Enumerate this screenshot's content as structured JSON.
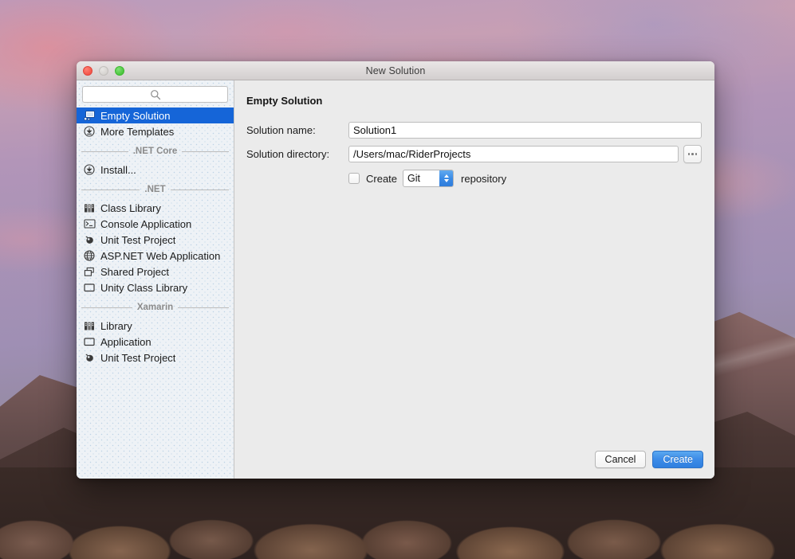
{
  "window": {
    "title": "New Solution",
    "traffic_lights": [
      {
        "name": "close",
        "color": "#f4564a"
      },
      {
        "name": "minimize",
        "color": "#d6d3d0"
      },
      {
        "name": "maximize",
        "color": "#4cc63d"
      }
    ]
  },
  "sidebar": {
    "search": {
      "value": "",
      "placeholder": "",
      "icon": "search-icon"
    },
    "top_items": [
      {
        "label": "Empty Solution",
        "icon": "empty-solution-icon",
        "selected": true
      },
      {
        "label": "More Templates",
        "icon": "download-circle-icon",
        "selected": false
      }
    ],
    "sections": [
      {
        "title": ".NET Core",
        "items": [
          {
            "label": "Install...",
            "icon": "download-circle-icon"
          }
        ]
      },
      {
        "title": ".NET",
        "items": [
          {
            "label": "Class Library",
            "icon": "class-library-icon"
          },
          {
            "label": "Console Application",
            "icon": "console-icon"
          },
          {
            "label": "Unit Test Project",
            "icon": "unit-test-icon"
          },
          {
            "label": "ASP.NET Web Application",
            "icon": "globe-icon"
          },
          {
            "label": "Shared Project",
            "icon": "shared-project-icon"
          },
          {
            "label": "Unity Class Library",
            "icon": "rectangle-icon"
          }
        ]
      },
      {
        "title": "Xamarin",
        "items": [
          {
            "label": "Library",
            "icon": "class-library-icon"
          },
          {
            "label": "Application",
            "icon": "rectangle-icon"
          },
          {
            "label": "Unit Test Project",
            "icon": "unit-test-icon"
          }
        ]
      }
    ]
  },
  "main": {
    "title": "Empty Solution",
    "fields": {
      "solution_name": {
        "label": "Solution name:",
        "value": "Solution1",
        "placeholder": ""
      },
      "solution_directory": {
        "label": "Solution directory:",
        "value": "/Users/mac/RiderProjects",
        "placeholder": "",
        "browse_button": "..."
      }
    },
    "vcs": {
      "checked": false,
      "create_label": "Create",
      "selected_option": "Git",
      "options": [
        "Git"
      ],
      "repository_label": "repository"
    },
    "buttons": {
      "cancel": "Cancel",
      "create": "Create"
    }
  },
  "colors": {
    "accent": "#1565d8",
    "primary_button": "#3d8ce8",
    "sidebar_bg": "#eef2f6",
    "panel_bg": "#ebebeb"
  }
}
